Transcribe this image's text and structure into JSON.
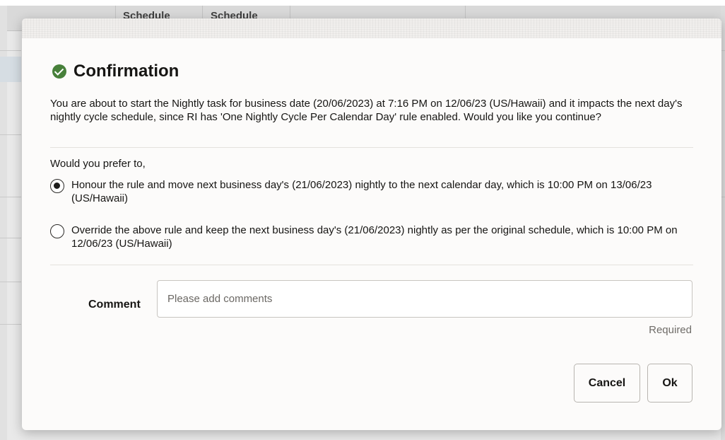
{
  "background": {
    "column_headers": [
      "Schedule",
      "Schedule"
    ]
  },
  "dialog": {
    "icon": "check-circle-icon",
    "title": "Confirmation",
    "message": "You are about to start the Nightly task for business date (20/06/2023) at 7:16 PM on 12/06/23 (US/Hawaii) and it impacts the next day's nightly cycle schedule, since RI has 'One Nightly Cycle Per Calendar Day' rule enabled. Would you like you continue?",
    "prompt": "Would you prefer to,",
    "options": [
      {
        "label": "Honour the rule and move next business day's (21/06/2023) nightly to the next calendar day, which is 10:00 PM on 13/06/23 (US/Hawaii)",
        "selected": true
      },
      {
        "label": "Override the above rule and keep the next business day's (21/06/2023) nightly as per the original schedule, which is 10:00 PM on 12/06/23 (US/Hawaii)",
        "selected": false
      }
    ],
    "comment": {
      "label": "Comment",
      "placeholder": "Please add comments",
      "value": "",
      "required_text": "Required"
    },
    "buttons": {
      "cancel": "Cancel",
      "ok": "Ok"
    }
  },
  "colors": {
    "accent_check": "#47803a",
    "overlay": "#e9e9e9",
    "dialog_bg": "#fcfbfa"
  }
}
